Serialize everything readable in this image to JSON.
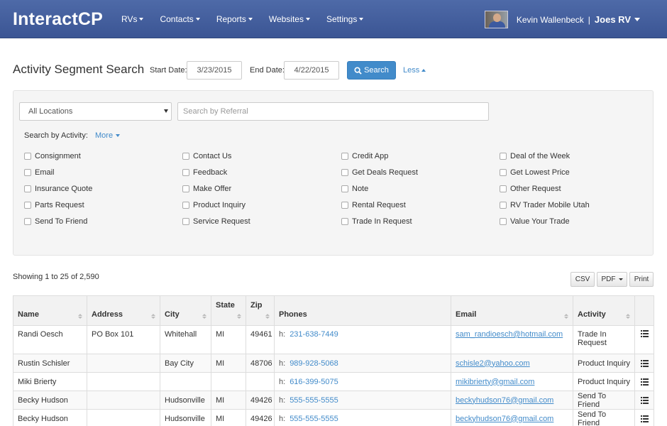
{
  "brand": "InteractCP",
  "nav": [
    "RVs",
    "Contacts",
    "Reports",
    "Websites",
    "Settings"
  ],
  "user": {
    "name": "Kevin Wallenbeck",
    "separator": "|",
    "dealer": "Joes RV"
  },
  "page": {
    "title": "Activity Segment Search",
    "start_label": "Start Date:",
    "start_value": "3/23/2015",
    "end_label": "End Date:",
    "end_value": "4/22/2015",
    "search_label": "Search",
    "less_label": "Less"
  },
  "filters": {
    "location_value": "All Locations",
    "referral_placeholder": "Search by Referral",
    "activity_label": "Search by Activity:",
    "more_label": "More",
    "activities": [
      "Consignment",
      "Contact Us",
      "Credit App",
      "Deal of the Week",
      "Email",
      "Feedback",
      "Get Deals Request",
      "Get Lowest Price",
      "Insurance Quote",
      "Make Offer",
      "Note",
      "Other Request",
      "Parts Request",
      "Product Inquiry",
      "Rental Request",
      "RV Trader Mobile Utah",
      "Send To Friend",
      "Service Request",
      "Trade In Request",
      "Value Your Trade"
    ]
  },
  "results": {
    "showing": "Showing 1 to 25 of 2,590",
    "buttons": {
      "csv": "CSV",
      "pdf": "PDF",
      "print": "Print"
    },
    "columns": [
      "Name",
      "Address",
      "City",
      "State",
      "Zip",
      "Phones",
      "Email",
      "Activity"
    ],
    "phone_prefix": "h:",
    "rows": [
      {
        "name": "Randi Oesch",
        "address": "PO Box 101",
        "city": "Whitehall",
        "state": "MI",
        "zip": "49461",
        "phone": "231-638-7449",
        "email": "sam_randioesch@hotmail.com",
        "activity": "Trade In Request"
      },
      {
        "name": "Rustin Schisler",
        "address": "",
        "city": "Bay City",
        "state": "MI",
        "zip": "48706",
        "phone": "989-928-5068",
        "email": "schisle2@yahoo.com",
        "activity": "Product Inquiry"
      },
      {
        "name": "Miki Brierty",
        "address": "",
        "city": "",
        "state": "",
        "zip": "",
        "phone": "616-399-5075",
        "email": "mikibrierty@gmail.com",
        "activity": "Product Inquiry"
      },
      {
        "name": "Becky Hudson",
        "address": "",
        "city": "Hudsonville",
        "state": "MI",
        "zip": "49426",
        "phone": "555-555-5555",
        "email": "beckyhudson76@gmail.com",
        "activity": "Send To Friend"
      },
      {
        "name": "Becky Hudson",
        "address": "",
        "city": "Hudsonville",
        "state": "MI",
        "zip": "49426",
        "phone": "555-555-5555",
        "email": "beckyhudson76@gmail.com",
        "activity": "Send To Friend"
      }
    ]
  },
  "colors": {
    "navbar": "#3f5a9a",
    "primary": "#428bca",
    "link": "#428bca"
  }
}
